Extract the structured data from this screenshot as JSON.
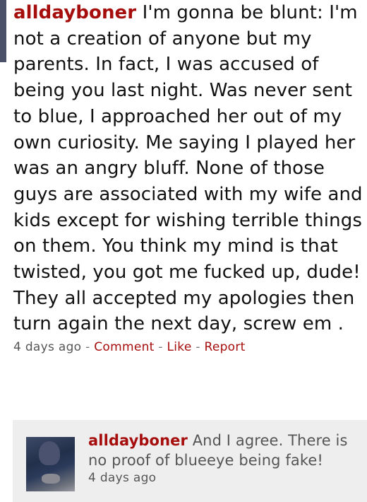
{
  "comment": {
    "username": "alldayboner",
    "text": "I'm gonna be blunt: I'm not a creation of anyone but my parents. In fact, I was accused of being you last night. Was never sent to blue, I approached her out of my own curiosity. Me saying I played her was an angry bluff. None of those guys are associated with my wife and kids except for wishing terrible things on them. You think my mind is that twisted, you got me fucked up, dude! They all accepted my apologies then turn again the next day, screw em .",
    "time": "4 days ago",
    "actions": {
      "separator": "-",
      "comment": "Comment",
      "like": "Like",
      "report": "Report"
    }
  },
  "reply": {
    "username": "alldayboner",
    "text": "And I agree. There is no proof of blueeye being fake!",
    "time": "4 days ago"
  },
  "colors": {
    "username": "#a60d0d",
    "link": "#a60d0d",
    "meta": "#555555",
    "reply_bg": "#eeeeee"
  }
}
